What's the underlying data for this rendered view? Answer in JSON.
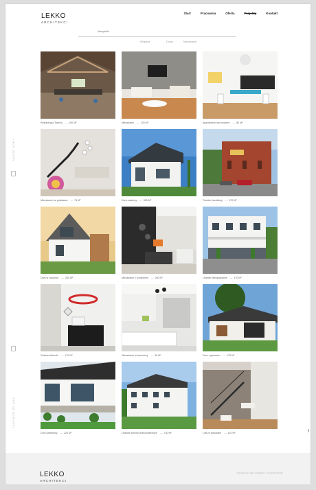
{
  "brand": {
    "name": "LEKKO",
    "sub": "ARCHITEKCI"
  },
  "nav": {
    "items": [
      "Start",
      "Pracownia",
      "Oferta",
      "Projekty",
      "Kontakt"
    ],
    "active_index": 3
  },
  "filters": [
    "Wszystkie",
    "Wnętrza",
    "Domy",
    "Mieszkania"
  ],
  "sidebar": {
    "left_top": "NASZE DOMY",
    "left_bottom": "ZADZWOŃ DO NAS"
  },
  "projects": [
    {
      "name": "Restauracja Tadeko",
      "area": "250 M²"
    },
    {
      "name": "Mieszkanie",
      "area": "120 M²"
    },
    {
      "name": "Apartament nad morzem",
      "area": "80 M²"
    },
    {
      "name": "Mieszkanie na poddaszu",
      "area": "74 M²"
    },
    {
      "name": "Dom rodzinny",
      "area": "300 M²"
    },
    {
      "name": "Pawilon handlowy",
      "area": "370 M²"
    },
    {
      "name": "Dom w Jasionce",
      "area": "250 M²"
    },
    {
      "name": "Mieszkanie z kominkiem",
      "area": "260 M²"
    },
    {
      "name": "Osiedle Mieszkaniowe",
      "area": "370 M²"
    },
    {
      "name": "Gabinet lekarski",
      "area": "170 M²"
    },
    {
      "name": "Mieszkanie w kamienicy",
      "area": "56 M²"
    },
    {
      "name": "Dom z garażem",
      "area": "170 M²"
    },
    {
      "name": "Dom parterowy",
      "area": "220 M²"
    },
    {
      "name": "Osiedle domów jednorodzinnych",
      "area": "730 M²"
    },
    {
      "name": "Loft ze schodami",
      "area": "110 M²"
    }
  ],
  "footer": {
    "copy": "Copyright by Lekko Architekci",
    "studio": "Created by Studio"
  },
  "colors": {
    "accent": "#222222",
    "caption": "#666666"
  },
  "icons": {
    "facebook": "f"
  }
}
